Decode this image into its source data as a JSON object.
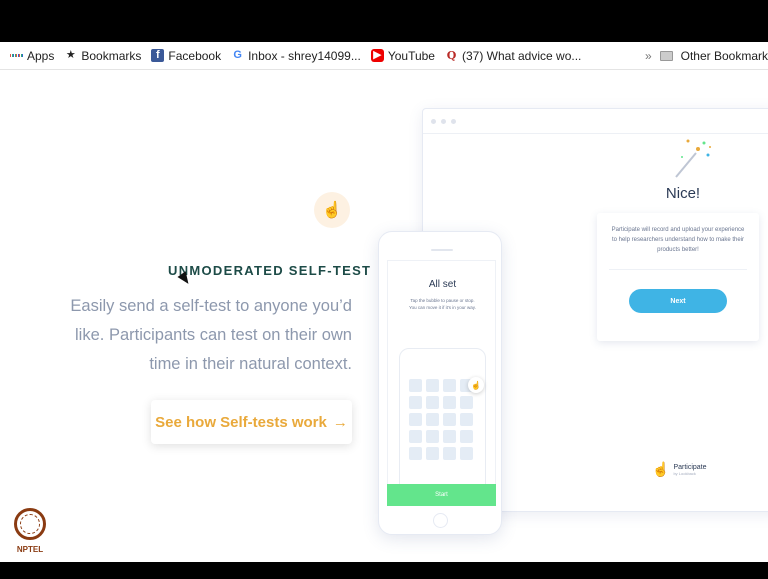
{
  "bookmarks_bar": {
    "items": [
      {
        "label": "Apps",
        "icon": "apps-grid-icon"
      },
      {
        "label": "Bookmarks",
        "icon": "star-icon"
      },
      {
        "label": "Facebook",
        "icon": "facebook-icon"
      },
      {
        "label": "Inbox - shrey14099...",
        "icon": "google-icon"
      },
      {
        "label": "YouTube",
        "icon": "youtube-icon"
      },
      {
        "label": "(37) What advice wo...",
        "icon": "quora-icon"
      }
    ],
    "overflow": "»",
    "other_bookmarks": "Other Bookmark"
  },
  "feature": {
    "heading": "UNMODERATED SELF-TEST",
    "description": "Easily send a self-test to anyone you’d like. Participants can test on their own time in their natural context.",
    "cta_label": "See how Self-tests work",
    "cta_arrow": "→",
    "accent_color": "#e9a93b",
    "heading_color": "#1d4b47"
  },
  "desktop_mockup": {
    "title": "Nice!",
    "body": "Participate will record and upload your experience to help researchers understand how to make their products better!",
    "next_label": "Next",
    "brand": "Participate",
    "brand_sub": "by Lookback",
    "button_color": "#3fb4e5"
  },
  "phone_mockup": {
    "title": "All set",
    "body": "Tap the bubble to pause or stop. You can move it if it’s in your way.",
    "start_label": "Start",
    "start_color": "#63e58c"
  },
  "watermark": {
    "label": "NPTEL"
  }
}
